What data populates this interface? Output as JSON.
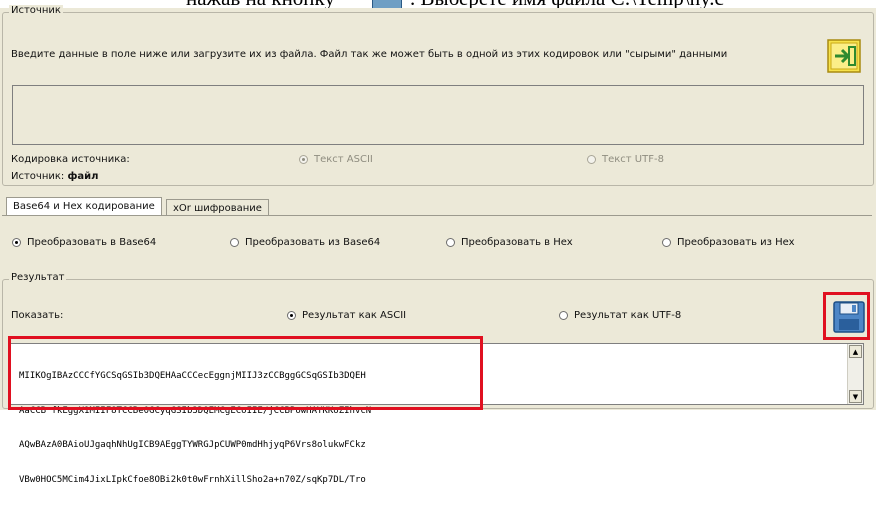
{
  "top_text": {
    "before": "нажав на кнопку",
    "after": ". Выберете имя файла C:\\Temp\\ny.c"
  },
  "source": {
    "title": "Источник",
    "description": "Введите данные в поле ниже или загрузите их из файла. Файл так же может быть в одной из этих кодировок или \"сырыми\" данными",
    "encoding_label": "Кодировка источника:",
    "encoding_options": [
      "Текст ASCII",
      "Текст UTF-8"
    ],
    "source_label": "Источник:",
    "source_value": "файл"
  },
  "tabs": [
    "Base64 и Hex кодирование",
    "xOr шифрование"
  ],
  "conversion_options": [
    "Преобразовать в Base64",
    "Преобразовать из Base64",
    "Преобразовать в Hex",
    "Преобразовать из Hex"
  ],
  "result": {
    "title": "Результат",
    "show_label": "Показать:",
    "options": [
      "Результат как ASCII",
      "Результат как UTF-8"
    ],
    "lines": [
      "MIIKOgIBAzCCCfYGCSqGSIb3DQEHAaCCCecEggnjMIIJ3zCCBggGCSqGSIb3DQEH",
      "AaCCB fkEggX1MIIF8TCCBe0GCyqGSIb3DQEMCgECoIIE/jCCBPowHAYKKoZIhvcN",
      "AQwBAzA0BAioUJgaqhNhUgICB9AEggTYWRGJpCUWP0mdHhjyqP6Vrs8olukwFCkz",
      "VBw0HOC5MCim4JixLIpkCfoe8OBi2k0t0wFrnhXillSho2a+n70Z/sqKp7DL/Tro"
    ]
  },
  "colors": {
    "highlight": "#e01020",
    "window_bg": "#ece9d8"
  }
}
